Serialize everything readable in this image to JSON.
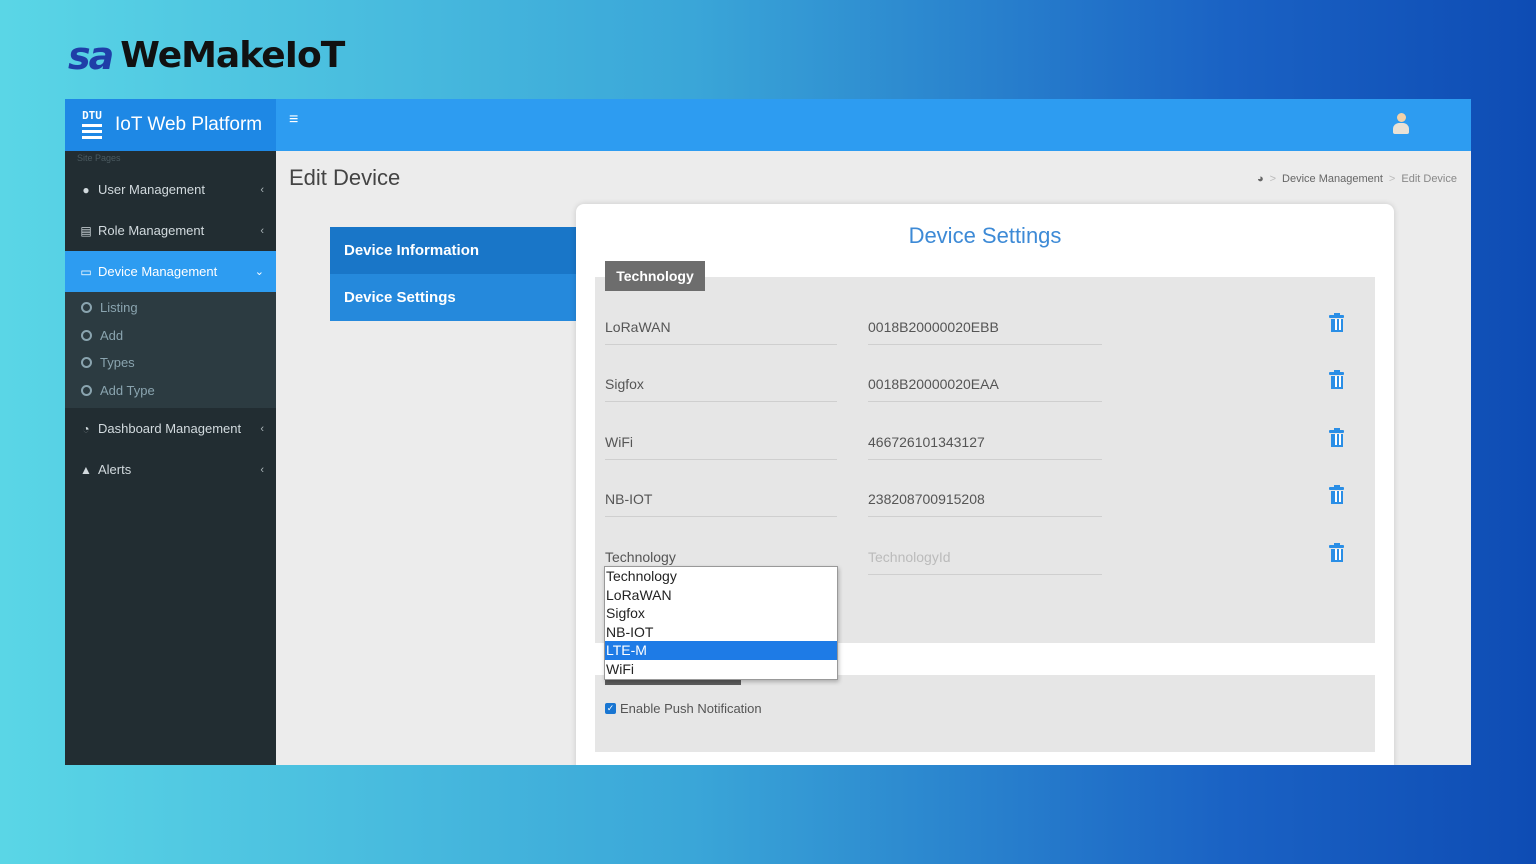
{
  "brand": {
    "mark": "sa",
    "name": "WeMakeIoT"
  },
  "app": {
    "logo_small": "DTU",
    "title": "IoT Web Platform",
    "menu_icon": "hamburger-icon",
    "user_icon": "user-avatar-icon"
  },
  "sidebar": {
    "hint": "Site Pages",
    "items": [
      {
        "label": "User Management",
        "icon": "user-circle-icon"
      },
      {
        "label": "Role Management",
        "icon": "id-card-icon"
      },
      {
        "label": "Device Management",
        "icon": "monitor-icon",
        "active": true
      },
      {
        "label": "Dashboard Management",
        "icon": "dashboard-icon"
      },
      {
        "label": "Alerts",
        "icon": "bell-icon"
      }
    ],
    "submenu": [
      "Listing",
      "Add",
      "Types",
      "Add Type"
    ]
  },
  "page": {
    "title": "Edit Device",
    "breadcrumb": {
      "home_icon": "dashboard-icon",
      "parent": "Device Management",
      "current": "Edit Device"
    }
  },
  "tabs": [
    "Device Information",
    "Device Settings"
  ],
  "card": {
    "title": "Device Settings",
    "section_tab": "Technology",
    "rows": [
      {
        "name": "LoRaWAN",
        "value": "0018B20000020EBB"
      },
      {
        "name": "Sigfox",
        "value": "0018B20000020EAA"
      },
      {
        "name": "WiFi",
        "value": "466726101343127"
      },
      {
        "name": "NB-IOT",
        "value": "238208700915208"
      },
      {
        "name": "Technology",
        "value_placeholder": "TechnologyId"
      }
    ],
    "dropdown_options": [
      "Technology",
      "LoRaWAN",
      "Sigfox",
      "NB-IOT",
      "LTE-M",
      "WiFi"
    ],
    "dropdown_selected": "LTE-M",
    "push_label": "Enable Push Notification",
    "push_checked": true
  },
  "colors": {
    "primary": "#2d9cf1",
    "sidebar": "#222d32",
    "accent_title": "#3d8ad6",
    "selected_option": "#1e7be6"
  }
}
